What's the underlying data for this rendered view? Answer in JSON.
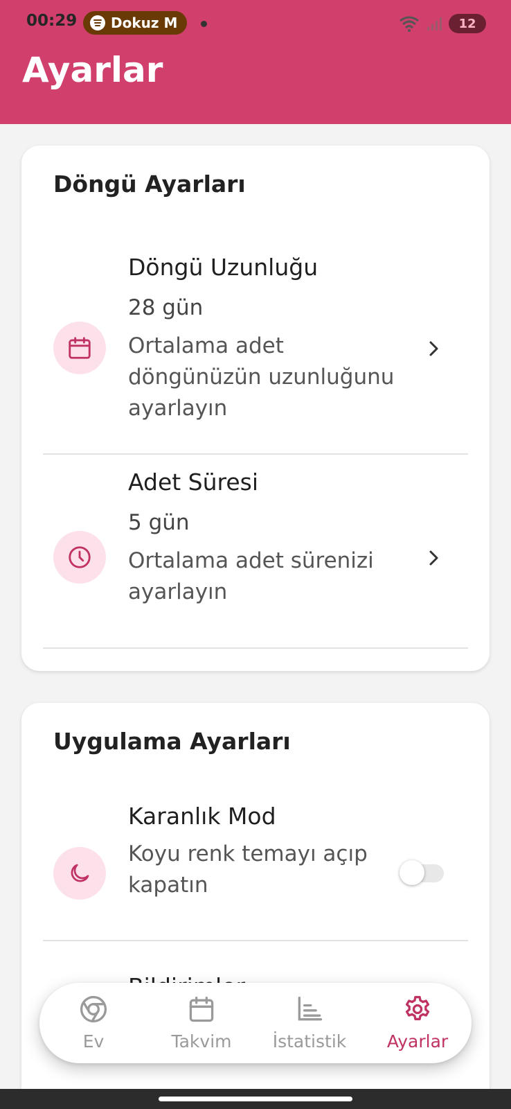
{
  "status_bar": {
    "time": "00:29",
    "media_text": "Dokuz M",
    "battery": "12"
  },
  "header": {
    "title": "Ayarlar"
  },
  "cycle_settings": {
    "title": "Döngü Ayarları",
    "items": [
      {
        "icon": "calendar-icon",
        "title": "Döngü Uzunluğu",
        "value": "28 gün",
        "description": "Ortalama adet döngünüzün uzunluğunu ayarlayın"
      },
      {
        "icon": "clock-icon",
        "title": "Adet Süresi",
        "value": "5 gün",
        "description": "Ortalama adet sürenizi ayarlayın"
      }
    ]
  },
  "app_settings": {
    "title": "Uygulama Ayarları",
    "items": [
      {
        "icon": "moon-icon",
        "title": "Karanlık Mod",
        "description": "Koyu renk temayı açıp kapatın",
        "toggle_on": false
      },
      {
        "title": "Bildirimler"
      }
    ]
  },
  "bottom_nav": {
    "items": [
      {
        "label": "Ev",
        "icon": "home-icon",
        "active": false
      },
      {
        "label": "Takvim",
        "icon": "calendar-icon",
        "active": false
      },
      {
        "label": "İstatistik",
        "icon": "chart-icon",
        "active": false
      },
      {
        "label": "Ayarlar",
        "icon": "gear-icon",
        "active": true
      }
    ]
  },
  "colors": {
    "accent": "#d13f6d",
    "icon_accent": "#c03264",
    "icon_bg": "#fde1ea",
    "inactive": "#9a9a9a"
  }
}
